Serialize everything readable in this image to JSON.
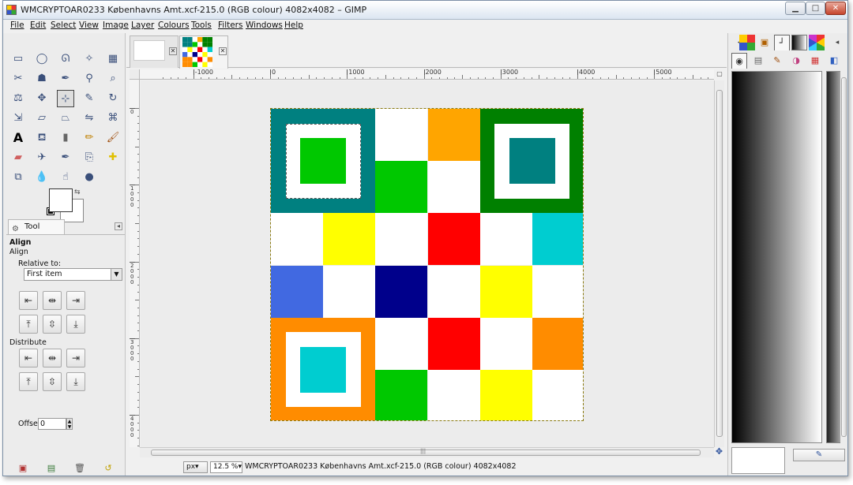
{
  "window": {
    "title": "WMCRYPTOAR0233 Københavns Amt.xcf-215.0 (RGB colour) 4082x4082 – GIMP",
    "minimize_label": "▁",
    "maximize_label": "□",
    "close_label": "✕"
  },
  "menubar": {
    "items": [
      "File",
      "Edit",
      "Select",
      "View",
      "Image",
      "Layer",
      "Colours",
      "Tools",
      "Filters",
      "Windows",
      "Help"
    ]
  },
  "toolbox": {
    "tools": [
      [
        "rect-select-icon",
        "ellipse-select-icon",
        "free-select-icon",
        "fuzzy-select-icon",
        "select-by-color-icon"
      ],
      [
        "scissors-icon",
        "foreground-select-icon",
        "paths-icon",
        "color-picker-icon",
        "zoom-icon"
      ],
      [
        "measure-icon",
        "move-icon",
        "align-icon",
        "crop-icon",
        "rotate-icon"
      ],
      [
        "scale-icon",
        "shear-icon",
        "perspective-icon",
        "flip-icon",
        "cage-icon"
      ],
      [
        "text-icon",
        "bucket-fill-icon",
        "blend-icon",
        "pencil-icon",
        "paintbrush-icon"
      ],
      [
        "eraser-icon",
        "airbrush-icon",
        "ink-icon",
        "clone-icon",
        "heal-icon"
      ],
      [
        "perspective-clone-icon",
        "blur-icon",
        "smudge-icon",
        "dodge-burn-icon"
      ]
    ],
    "active_tool": "align-icon",
    "foreground_color": "#ffffff",
    "background_color": "#ffffff"
  },
  "tool_options": {
    "tab_label": "Tool Options",
    "heading": "Align",
    "subheading": "Align",
    "relative_label": "Relative to:",
    "relative_value": "First item",
    "distribute_label": "Distribute",
    "offset_label": "Offset:",
    "offset_value": "0"
  },
  "image_window": {
    "ruler_labels_h": [
      "-1000",
      "0",
      "1000",
      "2000",
      "3000",
      "4000",
      "5000"
    ],
    "ruler_labels_v": [
      "0",
      "1000",
      "2000",
      "3000",
      "4000"
    ],
    "unit": "px▾",
    "zoom": "12.5 %▾",
    "status": "WMCRYPTOAR0233 Københavns Amt.xcf-215.0 (RGB colour) 4082x4082",
    "scroll_grip": "|||"
  },
  "image_grid": {
    "colors": {
      "W": "#ffffff",
      "T": "#008080",
      "G": "#00c800",
      "D": "#008000",
      "O": "#ffa500",
      "R": "#ff0000",
      "Y": "#ffff00",
      "C": "#00cdd0",
      "B": "#4169e1",
      "N": "#00008b",
      "A": "#ff8c00"
    },
    "rows": [
      [
        "T",
        "T",
        "W",
        "O",
        "D",
        "D"
      ],
      [
        "T",
        "T",
        "G",
        "W",
        "D",
        "D"
      ],
      [
        "W",
        "Y",
        "W",
        "R",
        "W",
        "C"
      ],
      [
        "B",
        "W",
        "N",
        "W",
        "Y",
        "W"
      ],
      [
        "A",
        "A",
        "W",
        "R",
        "W",
        "A"
      ],
      [
        "A",
        "A",
        "G",
        "W",
        "Y",
        "W"
      ]
    ],
    "finders": [
      {
        "outer": "T",
        "ring": "W",
        "inner": "G"
      },
      {
        "outer": "D",
        "ring": "W",
        "inner": "T"
      },
      {
        "outer": "A",
        "ring": "W",
        "inner": "C"
      }
    ]
  }
}
